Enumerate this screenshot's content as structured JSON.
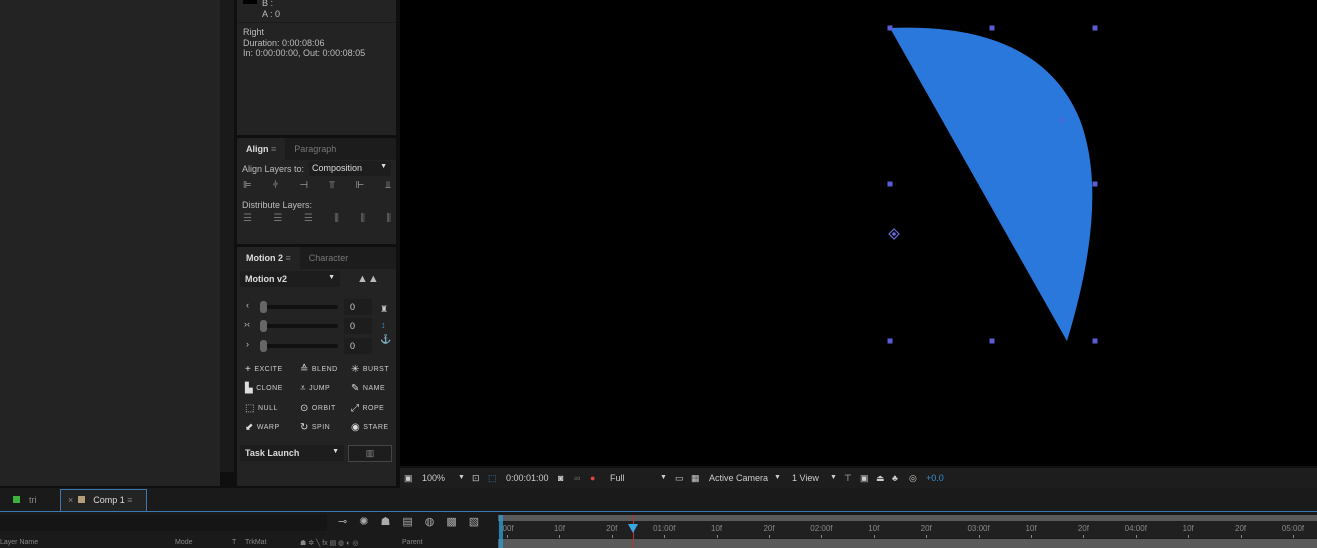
{
  "info": {
    "b_label": "B :",
    "a_label": "A : 0",
    "layer": "Right",
    "duration": "Duration: 0:00:08:06",
    "inout": "In: 0:00:00:00, Out: 0:00:08:05"
  },
  "align": {
    "tabs": [
      "Align",
      "Paragraph"
    ],
    "align_to_label": "Align Layers to:",
    "align_to_value": "Composition",
    "distribute_label": "Distribute Layers:"
  },
  "motion": {
    "tabs": [
      "Motion 2",
      "Character"
    ],
    "preset": "Motion v2",
    "sliders": [
      {
        "label": "‹",
        "value": "0"
      },
      {
        "label": "›‹",
        "value": "0"
      },
      {
        "label": "›",
        "value": "0"
      }
    ],
    "buttons": [
      "EXCITE",
      "BLEND",
      "BURST",
      "CLONE",
      "JUMP",
      "NAME",
      "NULL",
      "ORBIT",
      "ROPE",
      "WARP",
      "SPIN",
      "STARE"
    ],
    "task": "Task Launch"
  },
  "viewer": {
    "zoom": "100%",
    "timecode": "0:00:01:00",
    "resolution": "Full",
    "camera": "Active Camera",
    "views": "1 View",
    "exposure": "+0.0",
    "shape_color": "#2b78dd",
    "handle_color": "#5b5bd6"
  },
  "timeline": {
    "tabs": [
      "tri",
      "Comp 1"
    ],
    "columns": {
      "layer_name": "Layer Name",
      "mode": "Mode",
      "t": "T",
      "trkmat": "TrkMat",
      "parent": "Parent"
    },
    "ruler": [
      ":00f",
      "10f",
      "20f",
      "01:00f",
      "10f",
      "20f",
      "02:00f",
      "10f",
      "20f",
      "03:00f",
      "10f",
      "20f",
      "04:00f",
      "10f",
      "20f",
      "05:00f"
    ],
    "playhead_frames": 24
  }
}
